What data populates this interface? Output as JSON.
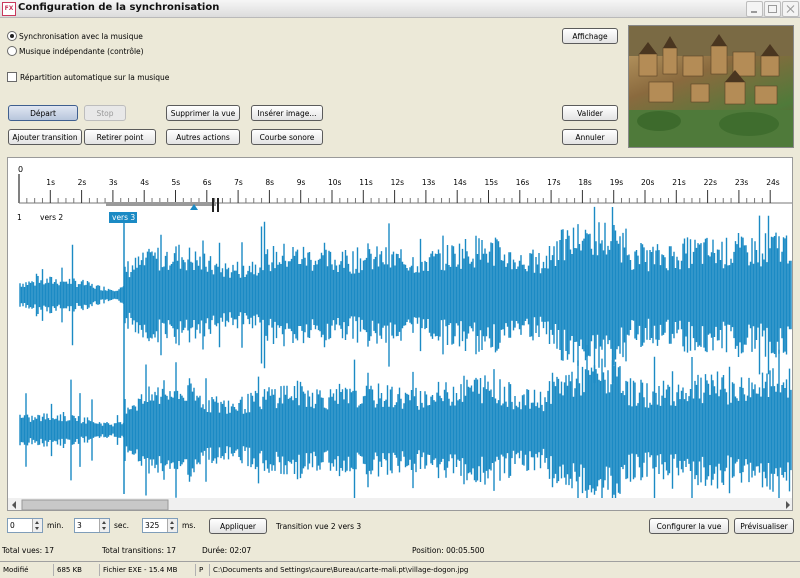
{
  "window": {
    "title": "Configuration de la synchronisation",
    "icon": "app-icon"
  },
  "sync_options": {
    "radio1": "Synchronisation avec la musique",
    "radio2": "Musique indépendante (contrôle)",
    "checkbox": "Répartition automatique sur la musique",
    "selected": "radio1"
  },
  "buttons": {
    "affichage": "Affichage",
    "depart": "Départ",
    "stop": "Stop",
    "supprimer_vue": "Supprimer la vue",
    "inserer_image": "Insérer image...",
    "valider": "Valider",
    "ajouter_transition": "Ajouter transition",
    "retirer_point": "Retirer point",
    "autres_actions": "Autres actions",
    "courbe_sonore": "Courbe sonore",
    "annuler": "Annuler",
    "appliquer": "Appliquer",
    "configurer_vue": "Configurer la vue",
    "previsualiser": "Prévisualiser"
  },
  "timeline": {
    "zero_label": "0",
    "ticks": [
      "1s",
      "2s",
      "3s",
      "4s",
      "5s",
      "6s",
      "7s",
      "8s",
      "9s",
      "10s",
      "11s",
      "12s",
      "13s",
      "14s",
      "15s",
      "16s",
      "17s",
      "18s",
      "19s",
      "20s",
      "21s",
      "22s",
      "23s",
      "24s"
    ],
    "view_labels": [
      "1",
      "vers 2",
      "vers 3"
    ],
    "selected_view": "vers 3",
    "waveform_color": "#1b8ac4",
    "marker_color": "#1b8ac4"
  },
  "time_controls": {
    "min_value": "0",
    "min_unit": "min.",
    "sec_value": "3",
    "sec_unit": "sec.",
    "ms_value": "325",
    "ms_unit": "ms.",
    "transition_label": "Transition vue 2 vers 3"
  },
  "summary": {
    "total_vues": "Total vues: 17",
    "total_transitions": "Total transitions: 17",
    "duree": "Durée: 02:07",
    "position": "Position: 00:05.500"
  },
  "statusbar": {
    "modifie": "Modifié",
    "size": "685 KB",
    "file_type": "Fichier EXE - 15.4 MB",
    "p": "P",
    "path": "C:\\Documents and Settings\\caure\\Bureau\\carte-mali.pt\\village-dogon.jpg"
  }
}
